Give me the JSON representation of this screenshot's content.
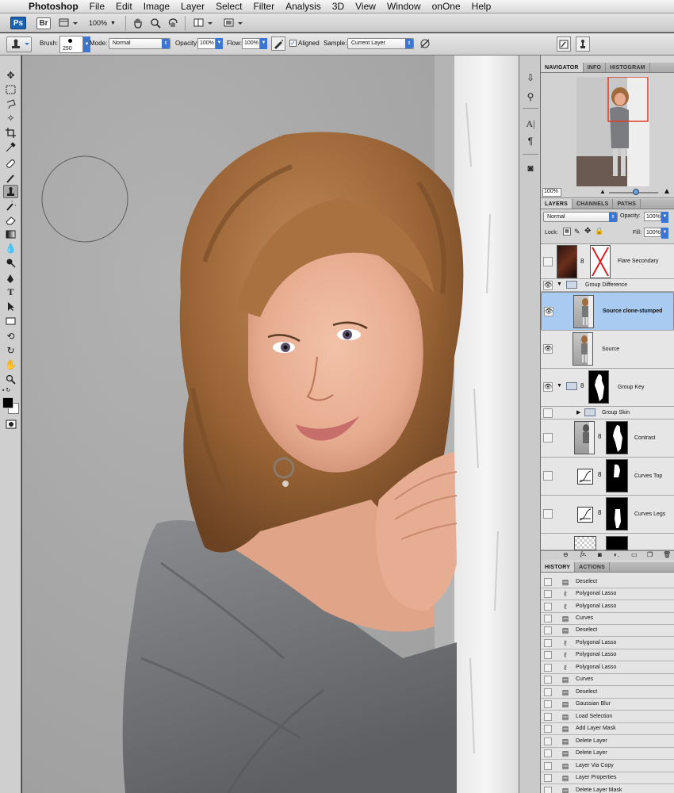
{
  "menubar": {
    "apple_icon": "apple-icon",
    "app_name": "Photoshop",
    "items": [
      "File",
      "Edit",
      "Image",
      "Layer",
      "Select",
      "Filter",
      "Analysis",
      "3D",
      "View",
      "Window",
      "onOne",
      "Help"
    ]
  },
  "appbar": {
    "ps_badge": "Ps",
    "br_badge": "Br",
    "zoom": "100%"
  },
  "options": {
    "brush_label": "Brush:",
    "brush_size": "250",
    "mode_label": "Mode:",
    "mode_value": "Normal",
    "opacity_label": "Opacity:",
    "opacity_value": "100%",
    "flow_label": "Flow:",
    "flow_value": "100%",
    "aligned_label": "Aligned",
    "aligned_checked": true,
    "sample_label": "Sample:",
    "sample_value": "Current Layer"
  },
  "navigator": {
    "tabs": [
      "NAVIGATOR",
      "INFO",
      "HISTOGRAM"
    ],
    "zoom": "100%"
  },
  "layers_panel": {
    "tabs": [
      "LAYERS",
      "CHANNELS",
      "PATHS"
    ],
    "blend_mode": "Normal",
    "opacity_label": "Opacity:",
    "opacity_value": "100%",
    "lock_label": "Lock:",
    "fill_label": "Fill:",
    "fill_value": "100%",
    "layers": [
      {
        "name": "Flare Secondary",
        "visible": false,
        "selected": false
      },
      {
        "name": "Group Difference",
        "visible": true,
        "selected": false,
        "group": true
      },
      {
        "name": "Source clone-stumped",
        "visible": true,
        "selected": true
      },
      {
        "name": "Source",
        "visible": true,
        "selected": false
      },
      {
        "name": "Group Key",
        "visible": true,
        "selected": false,
        "group": true
      },
      {
        "name": "Group Skin",
        "visible": false,
        "selected": false,
        "group": true
      },
      {
        "name": "Contrast",
        "visible": false,
        "selected": false
      },
      {
        "name": "Curves Top",
        "visible": false,
        "selected": false
      },
      {
        "name": "Curves Legs",
        "visible": false,
        "selected": false
      }
    ]
  },
  "history_panel": {
    "tabs": [
      "HISTORY",
      "ACTIONS"
    ],
    "items": [
      "Deselect",
      "Polygonal Lasso",
      "Polygonal Lasso",
      "Curves",
      "Deselect",
      "Polygonal Lasso",
      "Polygonal Lasso",
      "Polygonal Lasso",
      "Curves",
      "Deselect",
      "Gaussian Blur",
      "Load Selection",
      "Add Layer Mask",
      "Delete Layer",
      "Delete Layer",
      "Layer Via Copy",
      "Layer Properties",
      "Delete Layer Mask"
    ]
  }
}
